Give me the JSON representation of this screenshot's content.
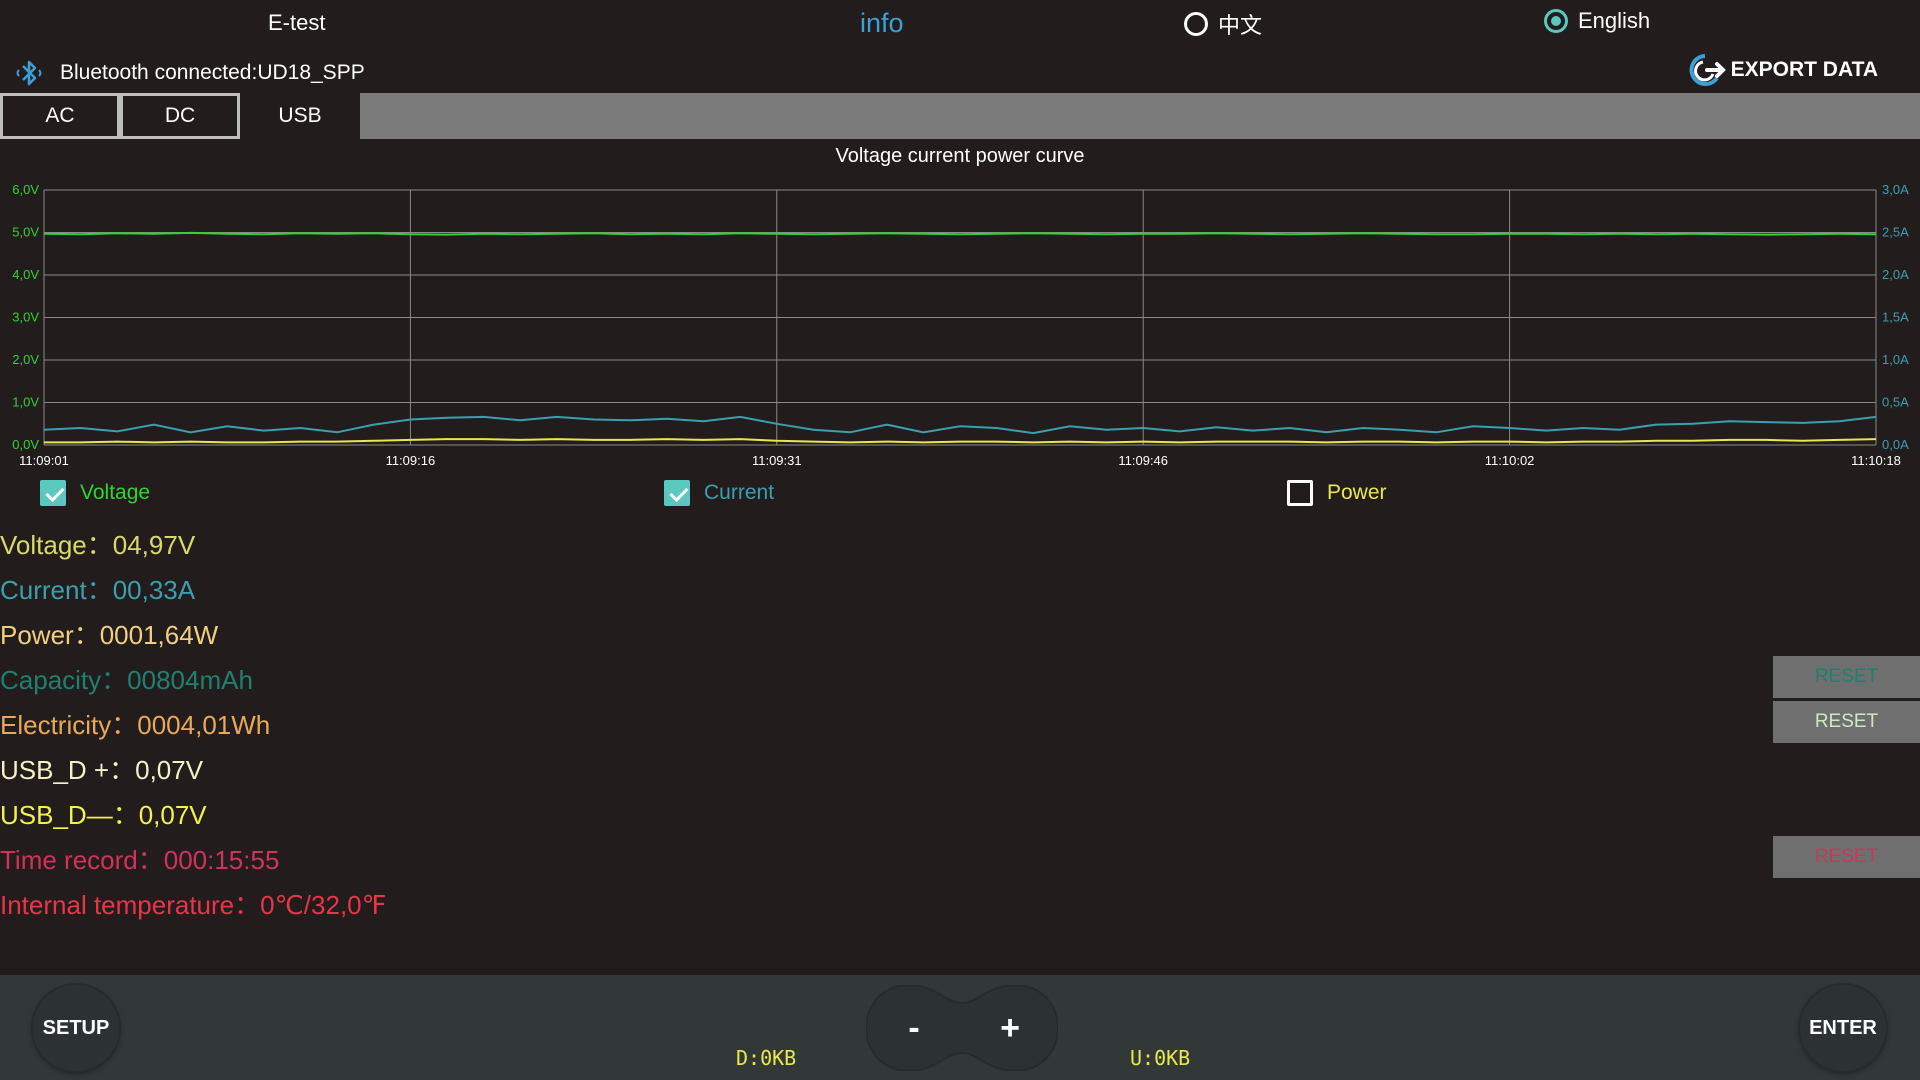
{
  "header": {
    "app_title": "E-test",
    "info_label": "info",
    "lang_zh": "中文",
    "lang_en": "English",
    "selected_language": "English",
    "bluetooth_status": "Bluetooth connected:UD18_SPP",
    "export_label": "EXPORT DATA"
  },
  "tabs": [
    {
      "label": "AC",
      "active": false
    },
    {
      "label": "DC",
      "active": false
    },
    {
      "label": "USB",
      "active": true
    }
  ],
  "chart_data": {
    "type": "line",
    "title": "Voltage current power curve",
    "x_ticks": [
      "11:09:01",
      "11:09:16",
      "11:09:31",
      "11:09:46",
      "11:10:02",
      "11:10:18"
    ],
    "y_left_ticks": [
      "0,0V",
      "1,0V",
      "2,0V",
      "3,0V",
      "4,0V",
      "5,0V",
      "6,0V"
    ],
    "y_right_ticks": [
      "0,0A",
      "0,5A",
      "1,0A",
      "1,5A",
      "2,0A",
      "2,5A",
      "3,0A"
    ],
    "y_left_range": [
      0,
      6
    ],
    "y_right_range": [
      0,
      3
    ],
    "grid": true,
    "series": [
      {
        "name": "Voltage",
        "axis": "left",
        "color": "#2fd42f",
        "values": [
          4.97,
          4.96,
          4.98,
          4.97,
          4.99,
          4.97,
          4.96,
          4.98,
          4.97,
          4.98,
          4.96,
          4.95,
          4.97,
          4.96,
          4.97,
          4.98,
          4.96,
          4.97,
          4.96,
          4.98,
          4.97,
          4.96,
          4.97,
          4.98,
          4.97,
          4.96,
          4.97,
          4.98,
          4.97,
          4.96,
          4.97,
          4.97,
          4.98,
          4.97,
          4.96,
          4.97,
          4.98,
          4.97,
          4.96,
          4.96,
          4.97,
          4.97,
          4.96,
          4.97,
          4.96,
          4.97,
          4.96,
          4.95,
          4.96,
          4.97,
          4.96
        ]
      },
      {
        "name": "Current",
        "axis": "right",
        "color": "#3b9fb0",
        "values": [
          0.18,
          0.2,
          0.16,
          0.24,
          0.15,
          0.22,
          0.17,
          0.2,
          0.15,
          0.24,
          0.3,
          0.32,
          0.33,
          0.29,
          0.33,
          0.3,
          0.29,
          0.31,
          0.28,
          0.33,
          0.25,
          0.18,
          0.15,
          0.24,
          0.15,
          0.22,
          0.2,
          0.14,
          0.22,
          0.18,
          0.2,
          0.16,
          0.21,
          0.17,
          0.2,
          0.15,
          0.2,
          0.18,
          0.15,
          0.22,
          0.2,
          0.17,
          0.2,
          0.18,
          0.24,
          0.25,
          0.28,
          0.27,
          0.26,
          0.28,
          0.33
        ]
      },
      {
        "name": "Power",
        "axis": "hidden",
        "color": "#e8e84a",
        "values": [
          0.03,
          0.03,
          0.04,
          0.03,
          0.04,
          0.03,
          0.03,
          0.04,
          0.04,
          0.05,
          0.06,
          0.07,
          0.07,
          0.06,
          0.07,
          0.06,
          0.06,
          0.07,
          0.06,
          0.07,
          0.05,
          0.04,
          0.03,
          0.04,
          0.03,
          0.04,
          0.04,
          0.03,
          0.04,
          0.03,
          0.04,
          0.03,
          0.04,
          0.04,
          0.04,
          0.03,
          0.04,
          0.04,
          0.03,
          0.04,
          0.04,
          0.03,
          0.04,
          0.04,
          0.05,
          0.05,
          0.06,
          0.06,
          0.05,
          0.06,
          0.07
        ]
      }
    ]
  },
  "legend": [
    {
      "label": "Voltage",
      "checked": true,
      "color": "#2fd42f"
    },
    {
      "label": "Current",
      "checked": true,
      "color": "#3b9fb0"
    },
    {
      "label": "Power",
      "checked": false,
      "color": "#e8e84a"
    }
  ],
  "readouts": {
    "voltage": {
      "label": "Voltage：",
      "value": "04,97V",
      "color": "#d9d96b"
    },
    "current": {
      "label": "Current：",
      "value": "00,33A",
      "color": "#3b9fb0"
    },
    "power": {
      "label": "Power：",
      "value": "0001,64W",
      "color": "#f0d080"
    },
    "capacity": {
      "label": "Capacity：",
      "value": "00804mAh",
      "color": "#1e8070"
    },
    "electricity": {
      "label": "Electricity：",
      "value": "0004,01Wh",
      "color": "#e8a95a"
    },
    "usb_dp": {
      "label": "USB_D +：",
      "value": "0,07V",
      "color": "#f4f0c8"
    },
    "usb_dm": {
      "label": "USB_D—：",
      "value": "0,07V",
      "color": "#f2f24a"
    },
    "time_record": {
      "label": "Time record：",
      "value": "000:15:55",
      "color": "#d0335a"
    },
    "temperature": {
      "label": "Internal temperature：",
      "value": "0℃/32,0℉",
      "color": "#e8354a"
    }
  },
  "reset_buttons": {
    "capacity": {
      "label": "RESET",
      "color": "#1e8070"
    },
    "electricity": {
      "label": "RESET",
      "color": "#cfe8c0"
    },
    "time": {
      "label": "RESET",
      "color": "#d0335a"
    }
  },
  "bottom": {
    "setup_label": "SETUP",
    "minus_label": "-",
    "plus_label": "+",
    "enter_label": "ENTER",
    "download": "D:0KB",
    "upload": "U:0KB"
  }
}
